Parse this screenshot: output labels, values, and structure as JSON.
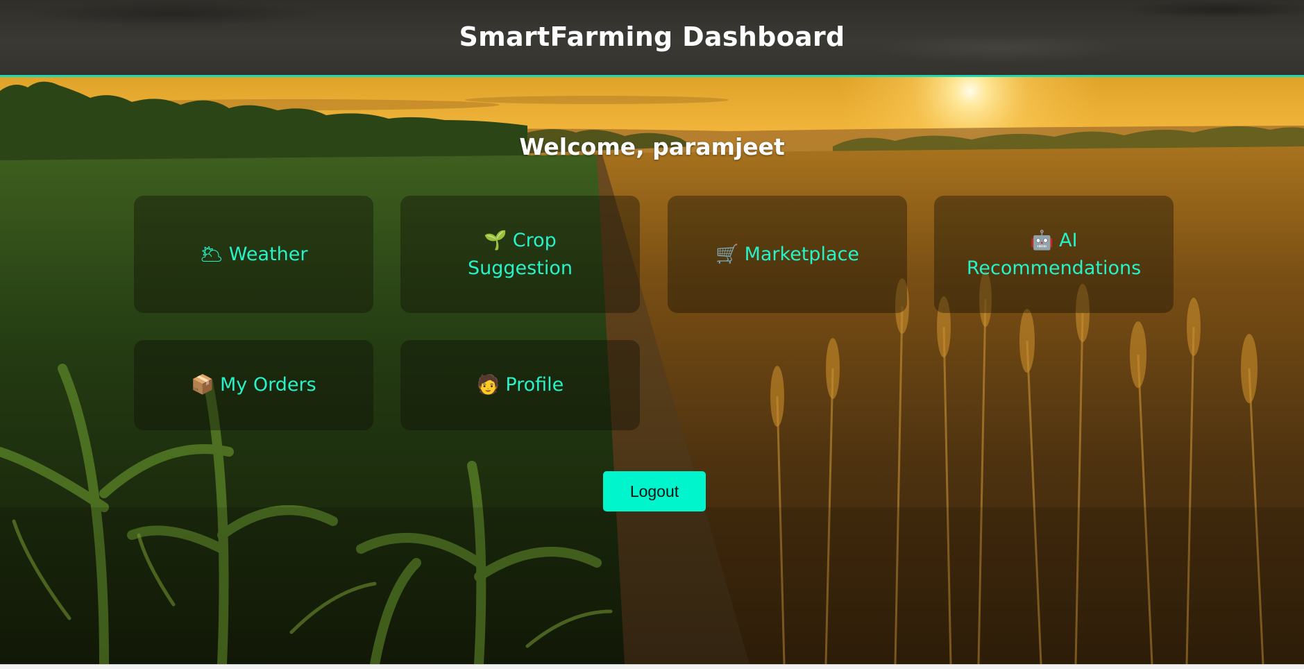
{
  "header": {
    "title": "SmartFarming Dashboard"
  },
  "welcome": {
    "text": "Welcome, paramjeet"
  },
  "cards": [
    {
      "icon": "🌥",
      "icon_name": "cloud-sun-icon",
      "label": "Weather"
    },
    {
      "icon": "🌱",
      "icon_name": "seedling-icon",
      "label": "Crop Suggestion"
    },
    {
      "icon": "🛒",
      "icon_name": "shopping-cart-icon",
      "label": "Marketplace"
    },
    {
      "icon": "🤖",
      "icon_name": "robot-icon",
      "label": "AI Recommendations"
    },
    {
      "icon": "📦",
      "icon_name": "package-icon",
      "label": "My Orders"
    },
    {
      "icon": "🧑",
      "icon_name": "user-icon",
      "label": "Profile"
    }
  ],
  "logout": {
    "label": "Logout"
  },
  "colors": {
    "accent": "#1fd9b3",
    "link_text": "#27f2c8",
    "button_bg": "#00f5cd"
  }
}
